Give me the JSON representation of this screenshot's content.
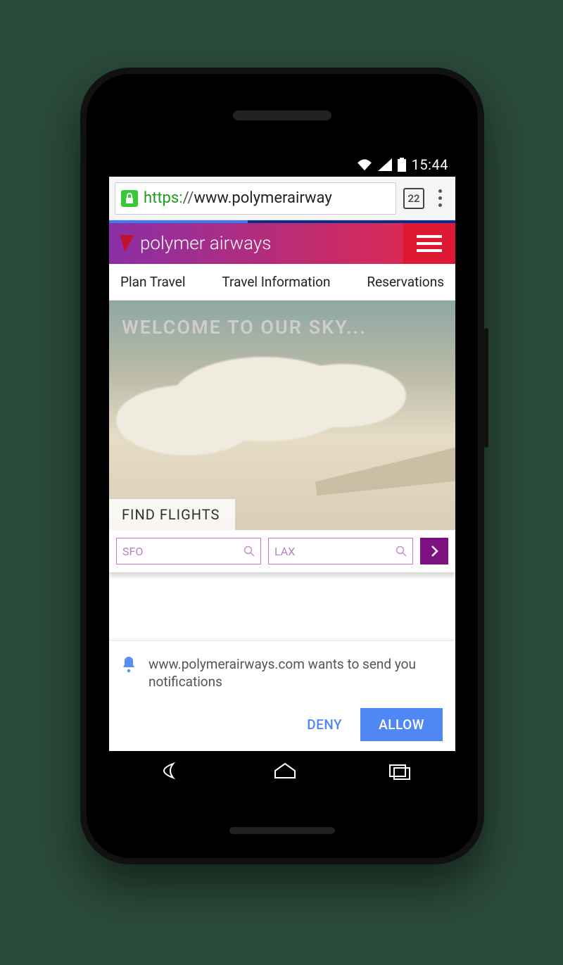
{
  "statusbar": {
    "time": "15:44"
  },
  "browser": {
    "url_scheme": "https:",
    "url_slashes": "//",
    "url_domain": "www.polymerairway",
    "tab_count": "22"
  },
  "site": {
    "brand": "polymer airways",
    "nav": {
      "plan": "Plan Travel",
      "info": "Travel Information",
      "res": "Reservations"
    },
    "hero_title": "WELCOME TO OUR SKY...",
    "find_flights": "FIND FLIGHTS",
    "from_placeholder": "SFO",
    "to_placeholder": "LAX"
  },
  "permission": {
    "text": "www.polymerairways.com wants to send you notifications",
    "deny": "DENY",
    "allow": "ALLOW"
  }
}
